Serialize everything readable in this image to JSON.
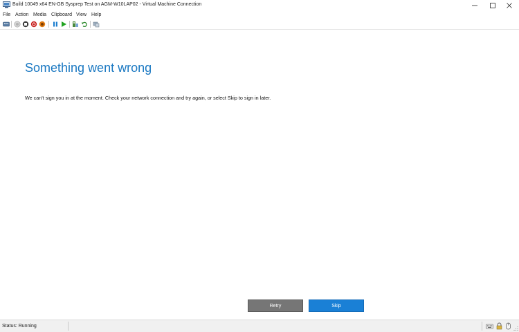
{
  "window": {
    "title": "Build 10049 x64 EN-GB Sysprep Test on AGM-W10LAP02 - Virtual Machine Connection"
  },
  "menu": {
    "items": [
      {
        "label": "File"
      },
      {
        "label": "Action"
      },
      {
        "label": "Media"
      },
      {
        "label": "Clipboard"
      },
      {
        "label": "View"
      },
      {
        "label": "Help"
      }
    ]
  },
  "toolbar": {
    "icons": [
      "ctrl-alt-del-icon",
      "start-icon",
      "turn-off-icon",
      "shut-down-icon",
      "save-state-icon",
      "pause-icon",
      "resume-icon",
      "checkpoint-icon",
      "revert-icon",
      "enhanced-session-icon"
    ]
  },
  "guest": {
    "heading": "Something went wrong",
    "message": "We can't sign you in at the moment. Check your network connection and try again, or select Skip to sign in later.",
    "retry_label": "Retry",
    "skip_label": "Skip"
  },
  "status": {
    "text": "Status: Running"
  },
  "colors": {
    "heading": "#1a78c2",
    "retry_bg": "#767676",
    "skip_bg": "#1a80d6"
  }
}
